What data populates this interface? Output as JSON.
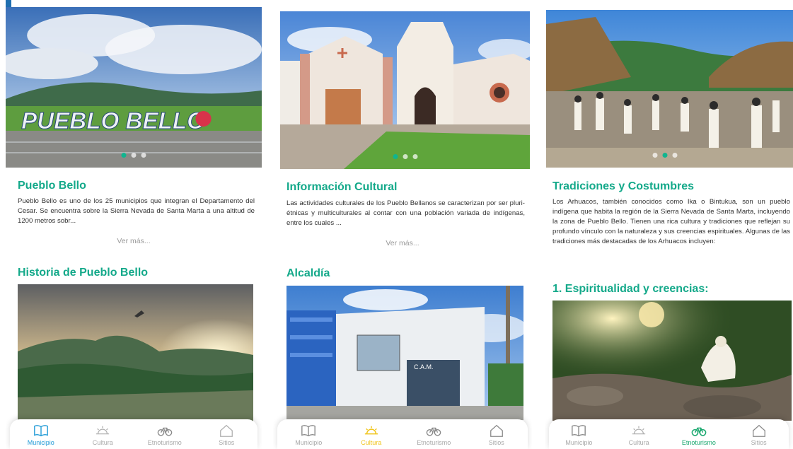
{
  "colors": {
    "accent": "#14a98a",
    "tab_municipio_active": "#1f9ad6",
    "tab_cultura_active": "#f0c419",
    "tab_etno_active": "#1aa86f"
  },
  "screen1": {
    "hero_sign": "PUEBLO BELLO",
    "title": "Pueblo Bello",
    "description": "Pueblo Bello es uno de los 25 municipios que integran el Departamento del Cesar. Se encuentra sobre la Sierra Nevada de Santa Marta a una altitud de 1200 metros sobr...",
    "more": "Ver más...",
    "subtitle": "Historia de Pueblo Bello"
  },
  "screen2": {
    "title": "Información Cultural",
    "description": "Las actividades culturales de los Pueblo Bellanos se caracterizan por ser pluri-étnicas y multiculturales al contar con una población variada de indígenas, entre los cuales ...",
    "more": "Ver más...",
    "subtitle": "Alcaldía",
    "building_sign": "C.A.M."
  },
  "screen3": {
    "title": "Tradiciones y Costumbres",
    "description": "Los Arhuacos, también conocidos como Ika o Bintukua, son un pueblo indígena que habita la región de la Sierra Nevada de Santa Marta, incluyendo la zona de Pueblo Bello. Tienen una rica cultura y tradiciones que reflejan su profundo vínculo con la naturaleza y sus creencias espirituales. Algunas de las tradiciones más destacadas de los Arhuacos incluyen:",
    "subtitle": "1. Espiritualidad y creencias:"
  },
  "tabs": [
    {
      "label": "Municipio",
      "icon": "book-icon"
    },
    {
      "label": "Cultura",
      "icon": "sunrise-icon"
    },
    {
      "label": "Etnoturismo",
      "icon": "bicycle-icon"
    },
    {
      "label": "Sitios",
      "icon": "house-icon"
    }
  ]
}
